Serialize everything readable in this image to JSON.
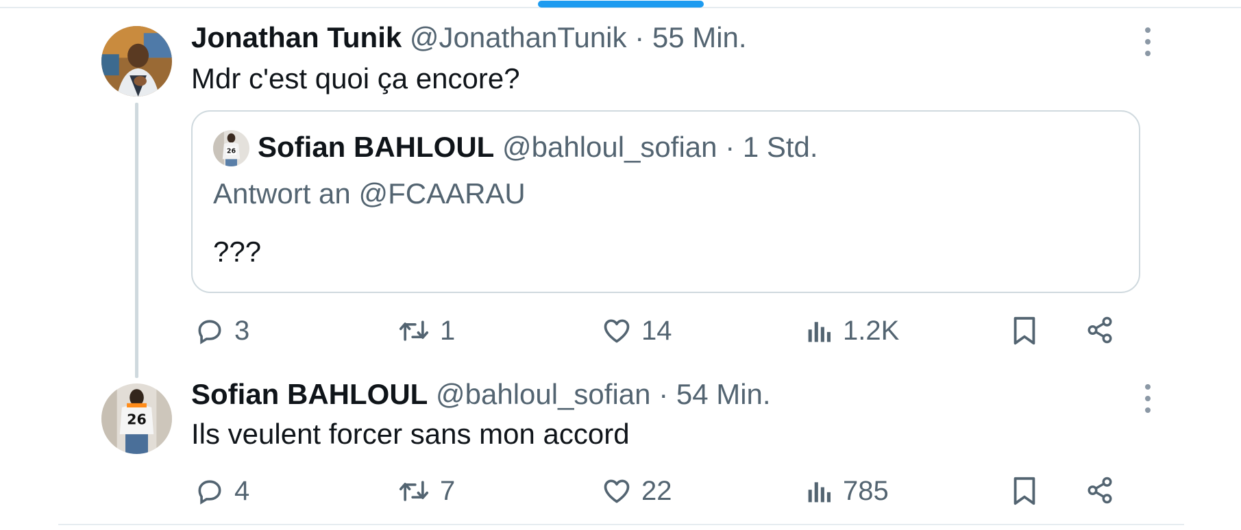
{
  "colors": {
    "accent": "#1d9bf0",
    "secondary_text": "#536471",
    "primary_text": "#0f1419",
    "border": "#cfd9de"
  },
  "tweets": [
    {
      "display_name": "Jonathan Tunik",
      "handle": "@JonathanTunik",
      "time": "· 55 Min.",
      "text": "Mdr c'est quoi ça encore?",
      "avatar_icon": "avatar-photo",
      "quote": {
        "display_name": "Sofian BAHLOUL",
        "handle": "@bahloul_sofian",
        "time": "· 1 Std.",
        "reply_to": "Antwort an @FCAARAU",
        "text": "???"
      },
      "actions": {
        "replies": "3",
        "retweets": "1",
        "likes": "14",
        "views": "1.2K"
      }
    },
    {
      "display_name": "Sofian BAHLOUL",
      "handle": "@bahloul_sofian",
      "time": "· 54 Min.",
      "text": "Ils veulent forcer sans mon accord",
      "avatar_icon": "avatar-photo",
      "actions": {
        "replies": "4",
        "retweets": "7",
        "likes": "22",
        "views": "785"
      }
    }
  ]
}
